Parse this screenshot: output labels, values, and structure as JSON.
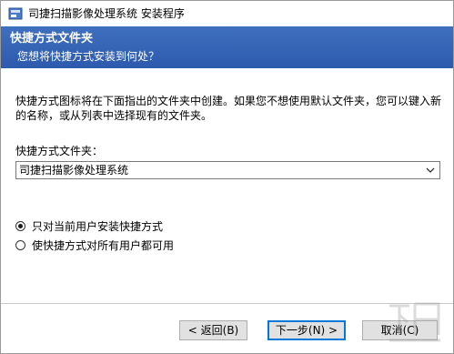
{
  "window": {
    "title": "司捷扫描影像处理系统 安装程序"
  },
  "header": {
    "title": "快捷方式文件夹",
    "subtitle": "您想将快捷方式安装到何处？"
  },
  "body": {
    "description": "快捷方式图标将在下面指出的文件夹中创建。如果您不想使用默认文件夹，您可以键入新的名称，或从列表中选择现有的文件夹。",
    "folder_label": "快捷方式文件夹：",
    "folder_value": "司捷扫描影像处理系统"
  },
  "options": [
    {
      "label": "只对当前用户安装快捷方式",
      "selected": true
    },
    {
      "label": "使快捷方式对所有用户都可用",
      "selected": false
    }
  ],
  "buttons": {
    "back": "< 返回(B)",
    "next": "下一步(N) >",
    "cancel": "取消(C)"
  },
  "watermark": {
    "text": "下载吧"
  },
  "colors": {
    "header_bg": "#2d5aad",
    "accent": "#0078d7"
  }
}
